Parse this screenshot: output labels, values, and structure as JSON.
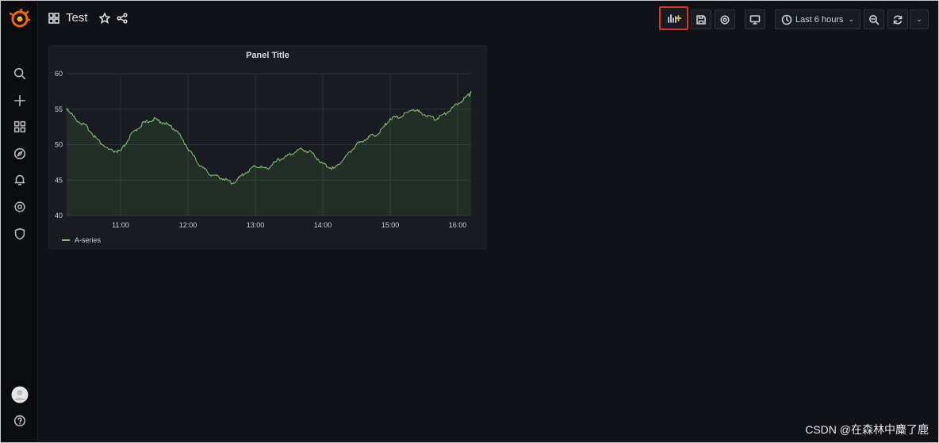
{
  "dashboard": {
    "title": "Test"
  },
  "toolbar": {
    "time_range_label": "Last 6 hours"
  },
  "panel": {
    "title": "Panel Title"
  },
  "chart_data": {
    "type": "line",
    "title": "Panel Title",
    "x_ticks": [
      "11:00",
      "12:00",
      "13:00",
      "14:00",
      "15:00",
      "16:00"
    ],
    "ylim": [
      40,
      60
    ],
    "y_ticks": [
      40,
      45,
      50,
      55,
      60
    ],
    "grid": true,
    "legend_position": "bottom-left",
    "series": [
      {
        "name": "A-series",
        "color": "#73bf69",
        "x": [
          "10:12",
          "10:20",
          "10:30",
          "10:40",
          "10:50",
          "11:00",
          "11:10",
          "11:20",
          "11:30",
          "11:40",
          "11:50",
          "12:00",
          "12:10",
          "12:20",
          "12:30",
          "12:40",
          "12:50",
          "13:00",
          "13:10",
          "13:20",
          "13:30",
          "13:40",
          "13:50",
          "14:00",
          "14:10",
          "14:20",
          "14:30",
          "14:40",
          "14:50",
          "15:00",
          "15:10",
          "15:20",
          "15:30",
          "15:40",
          "15:50",
          "16:00",
          "16:10",
          "16:12"
        ],
        "values": [
          55.2,
          53.6,
          52.5,
          50.6,
          49.2,
          49.0,
          51.5,
          53.0,
          53.6,
          53.0,
          52.0,
          49.5,
          47.2,
          45.8,
          45.3,
          44.6,
          45.9,
          47.0,
          46.6,
          47.8,
          48.5,
          49.4,
          48.9,
          47.3,
          46.6,
          48.2,
          50.0,
          51.0,
          51.6,
          53.7,
          54.0,
          55.0,
          54.3,
          53.6,
          54.5,
          55.8,
          57.0,
          57.3
        ]
      }
    ]
  },
  "footer": {
    "watermark": "CSDN @在森林中麋了鹿"
  },
  "colors": {
    "background": "#111217",
    "panel": "#181b1f",
    "series": "#73bf69",
    "highlight": "#e02f2f",
    "logo": "#f46800"
  },
  "icons": [
    "grafana-logo-icon",
    "search-icon",
    "plus-icon",
    "dashboards-icon",
    "explore-icon",
    "alerting-icon",
    "settings-icon",
    "shield-icon",
    "avatar",
    "help-icon",
    "grid-icon",
    "star-icon",
    "share-icon",
    "add-panel-icon",
    "save-icon",
    "gear-icon",
    "tv-icon",
    "clock-icon",
    "zoom-out-icon",
    "refresh-icon",
    "chevron-down-icon"
  ]
}
